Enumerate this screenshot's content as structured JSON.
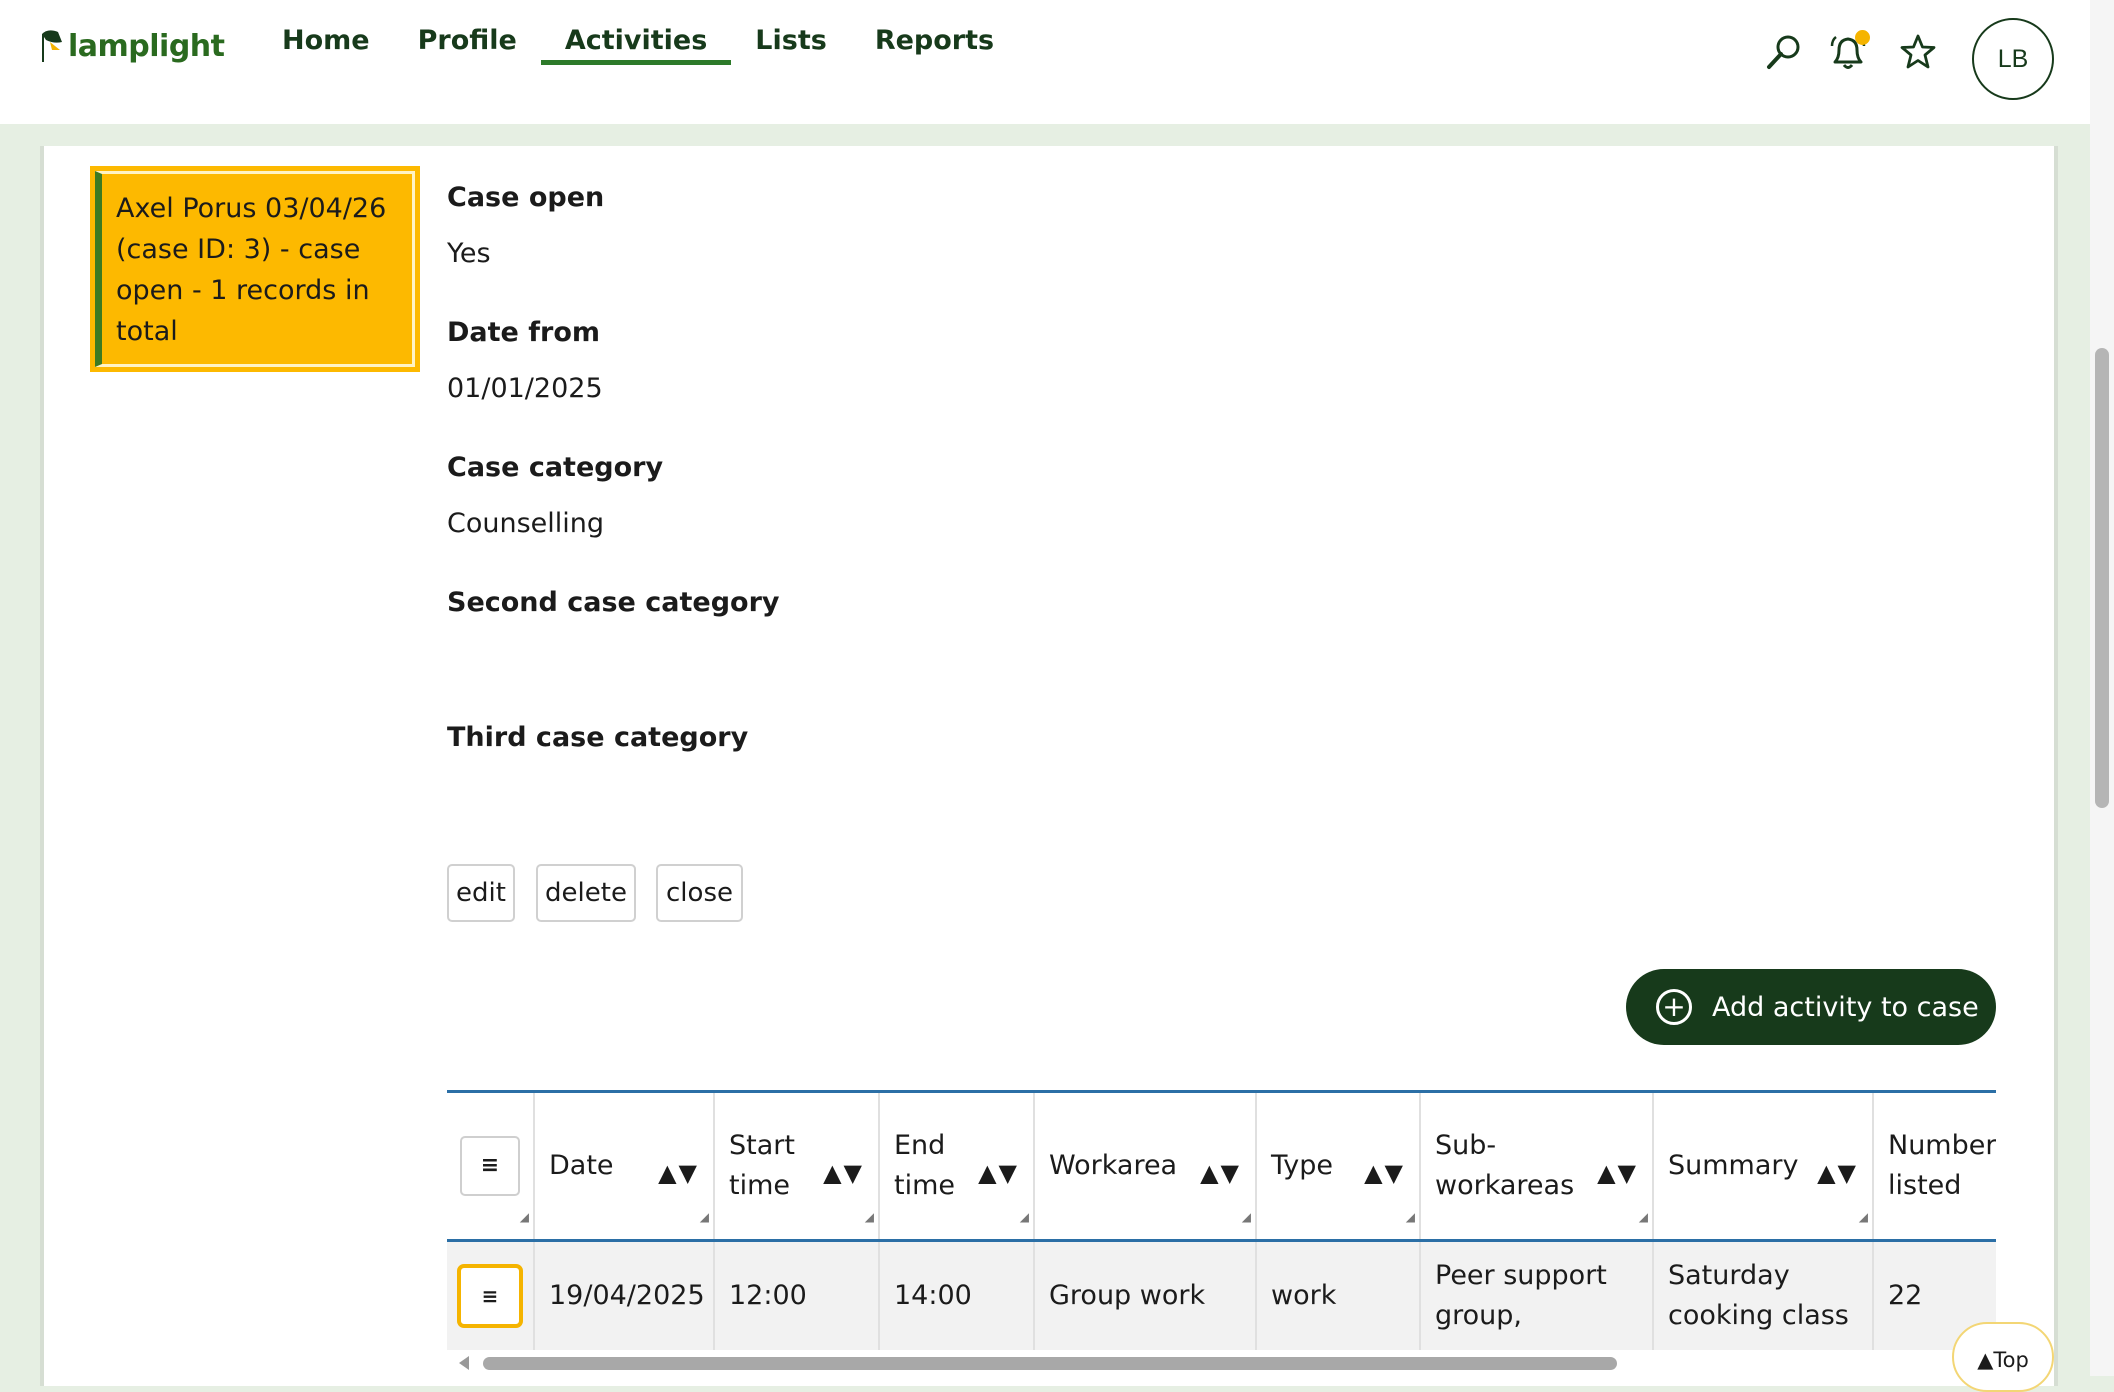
{
  "app": {
    "logo_text": "lamplight"
  },
  "nav": {
    "items": [
      {
        "label": "Home"
      },
      {
        "label": "Profile"
      },
      {
        "label": "Activities",
        "active": true
      },
      {
        "label": "Lists"
      },
      {
        "label": "Reports"
      }
    ]
  },
  "header_icons": {
    "search": "search-icon",
    "notifications": "bell-icon",
    "favourites": "star-icon",
    "avatar_initials": "LB",
    "notification_dot_color": "#f5b400"
  },
  "case_card": {
    "text": "Axel Porus 03/04/26 (case ID: 3) - case open - 1 records in total",
    "background": "#fdb900"
  },
  "fields": [
    {
      "label": "Case open",
      "value": "Yes"
    },
    {
      "label": "Date from",
      "value": "01/01/2025"
    },
    {
      "label": "Case category",
      "value": "Counselling"
    },
    {
      "label": "Second case category",
      "value": ""
    },
    {
      "label": "Third case category",
      "value": ""
    }
  ],
  "actions": {
    "edit": "edit",
    "delete": "delete",
    "close": "close",
    "add_activity": "Add activity to case"
  },
  "table": {
    "columns": [
      {
        "label": "",
        "sortable": false
      },
      {
        "label": "Date",
        "sortable": true
      },
      {
        "label": "Start time",
        "sortable": true
      },
      {
        "label": "End time",
        "sortable": true
      },
      {
        "label": "Workarea",
        "sortable": true
      },
      {
        "label": "Type",
        "sortable": true
      },
      {
        "label": "Sub-workareas",
        "sortable": true
      },
      {
        "label": "Summary",
        "sortable": true
      },
      {
        "label": "Number listed",
        "sortable": false
      }
    ],
    "sort_glyph": "▲▼",
    "menu_glyph": "≡",
    "rows": [
      {
        "date": "19/04/2025",
        "start_time": "12:00",
        "end_time": "14:00",
        "workarea": "Group work",
        "type": "work",
        "sub_workareas": "Peer support group,",
        "summary": "Saturday cooking class",
        "number_listed": "22"
      }
    ]
  },
  "top_button": "▲Top",
  "colors": {
    "brand_dark": "#173a1b",
    "brand_green": "#2d7a2a",
    "accent_yellow": "#fdb900",
    "table_border": "#2b6fa6"
  }
}
